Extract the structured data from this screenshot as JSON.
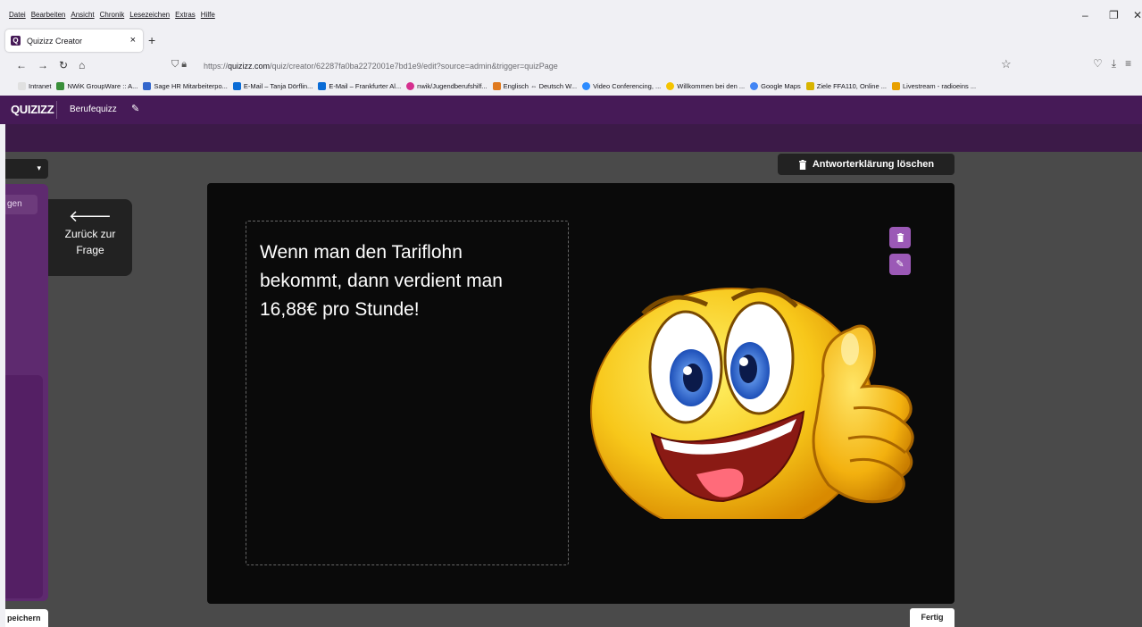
{
  "browser": {
    "menu": [
      "Datei",
      "Bearbeiten",
      "Ansicht",
      "Chronik",
      "Lesezeichen",
      "Extras",
      "Hilfe"
    ],
    "tab_title": "Quizizz Creator",
    "tab_favicon": "Q",
    "url_prefix": "https://",
    "url_domain": "quizizz.com",
    "url_path": "/quiz/creator/62287fa0ba2272001e7bd1e9/edit?source=admin&trigger=quizPage",
    "bookmarks": [
      {
        "label": "Intranet",
        "color": "#e0e0e0"
      },
      {
        "label": "NWiK GroupWare :: A...",
        "color": "#3a8f3a"
      },
      {
        "label": "Sage HR Mitarbeiterpo...",
        "color": "#3366cc"
      },
      {
        "label": "E-Mail – Tanja Dörflin...",
        "color": "#0a6cd6"
      },
      {
        "label": "E-Mail – Frankfurter Al...",
        "color": "#0a6cd6"
      },
      {
        "label": "nwik/Jugendberufshilf...",
        "color": "#d6308f"
      },
      {
        "label": "Englisch ⇔ Deutsch W...",
        "color": "#e07a1f"
      },
      {
        "label": "Video Conferencing, ...",
        "color": "#2d8cff"
      },
      {
        "label": "Willkommen bei den ...",
        "color": "#f5c400"
      },
      {
        "label": "Google Maps",
        "color": "#4285f4"
      },
      {
        "label": "Ziele FFA110, Online ...",
        "color": "#d8b400"
      },
      {
        "label": "Livestream - radioeins ...",
        "color": "#e8a000"
      }
    ]
  },
  "app": {
    "logo": "QUIZIZZ",
    "quiz_name": "Berufequizz",
    "left_pill": "gen",
    "back_label_1": "Zurück zur",
    "back_label_2": "Frage",
    "delete_explanation": "Antworterklärung löschen",
    "explanation_text": "Wenn man den Tariflohn bekommt, dann verdient man 16,88€ pro Stunde!",
    "save_label": "peichern",
    "done_label": "Fertig",
    "accent_color": "#461a57",
    "image_icon": "thumbs-up-emoji"
  }
}
